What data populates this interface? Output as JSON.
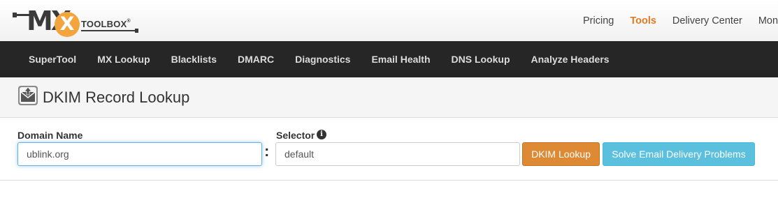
{
  "logo": {
    "mark": "MX",
    "badge": "X",
    "text": "TOOLBOX",
    "registered": "®"
  },
  "top_nav": [
    {
      "label": "Pricing",
      "active": false
    },
    {
      "label": "Tools",
      "active": true
    },
    {
      "label": "Delivery Center",
      "active": false
    },
    {
      "label": "Monit",
      "active": false
    }
  ],
  "main_nav": [
    "SuperTool",
    "MX Lookup",
    "Blacklists",
    "DMARC",
    "Diagnostics",
    "Email Health",
    "DNS Lookup",
    "Analyze Headers"
  ],
  "page": {
    "title": "DKIM Record Lookup",
    "icon": "envelope-upload-icon"
  },
  "form": {
    "domain_label": "Domain Name",
    "domain_value": "ublink.org",
    "separator": ":",
    "selector_label": "Selector",
    "selector_info_icon": "info-circle-icon",
    "selector_value": "default",
    "lookup_button": "DKIM Lookup",
    "solve_button": "Solve Email Delivery Problems"
  },
  "colors": {
    "accent_orange": "#e07a24",
    "nav_bg": "#262626",
    "lookup_button": "#de8a34",
    "solve_button": "#5bc0de",
    "focus_border": "#66afe9"
  }
}
